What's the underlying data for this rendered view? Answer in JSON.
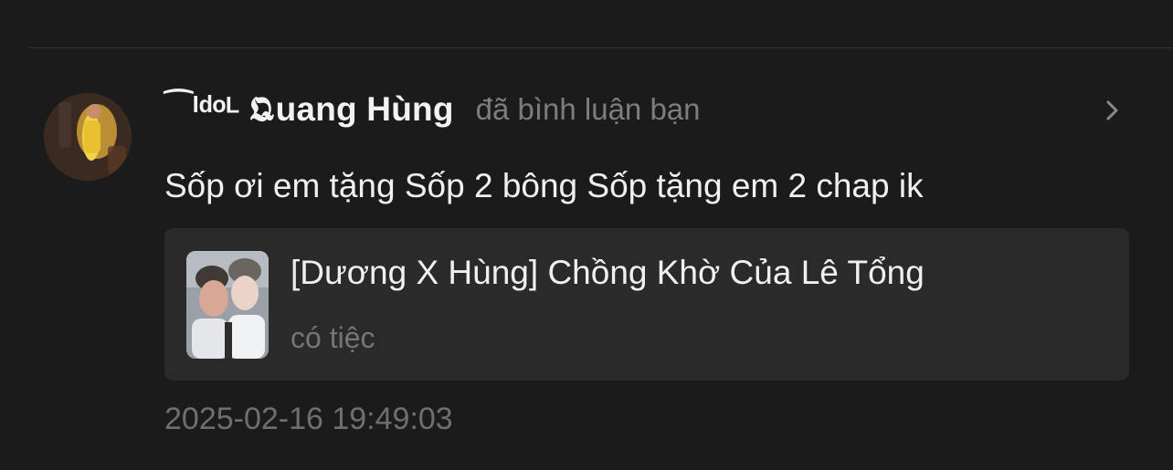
{
  "notification": {
    "username": "⁀ᴵᵈᵒᴸ 𝕼uang Hùng",
    "action": "đã bình luận bạn",
    "comment": "Sốp ơi em tặng Sốp 2 bông Sốp tặng em 2 chap ik",
    "story": {
      "title": "[Dương X Hùng] Chồng Khờ Của Lê Tổng",
      "subtitle": "có tiệc"
    },
    "timestamp": "2025-02-16 19:49:03"
  },
  "icons": {
    "avatar": "user-avatar-photo",
    "thumbnail": "story-cover-photo",
    "chevron": "chevron-right-icon"
  },
  "colors": {
    "background": "#1b1b1b",
    "card": "#2a2a2a",
    "primary_text": "#f0f0f0",
    "secondary_text": "#7d7d7d"
  }
}
